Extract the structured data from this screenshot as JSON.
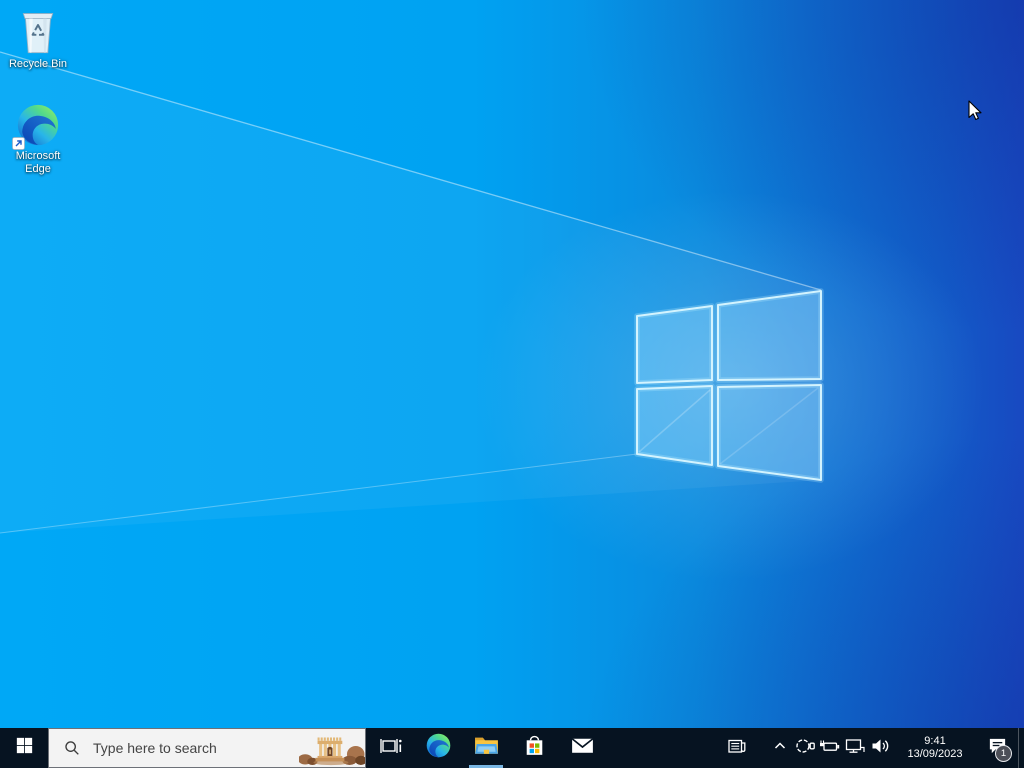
{
  "os": {
    "shell": "Windows 10 desktop",
    "accent_colors": {
      "wallpaper_left": "#00a8f6",
      "wallpaper_right": "#1849c1",
      "taskbar_background": "#061321",
      "running_indicator": "#79b6e3"
    }
  },
  "desktop_icons": [
    {
      "id": "recycle-bin",
      "label": "Recycle Bin",
      "icon": "recycle-bin-icon"
    },
    {
      "id": "microsoft-edge",
      "label_line1": "Microsoft",
      "label_line2": "Edge",
      "icon": "edge-icon"
    }
  ],
  "taskbar": {
    "start": {
      "icon": "windows-logo-icon"
    },
    "search": {
      "placeholder": "Type here to search",
      "icon": "search-icon",
      "highlight_icon": "temple-ruins-illustration"
    },
    "buttons": [
      {
        "id": "task-view",
        "icon": "task-view-icon",
        "running": false
      },
      {
        "id": "edge",
        "icon": "edge-icon",
        "running": false
      },
      {
        "id": "file-explorer",
        "icon": "file-explorer-icon",
        "running": true
      },
      {
        "id": "microsoft-store",
        "icon": "store-icon",
        "running": false
      },
      {
        "id": "mail",
        "icon": "mail-icon",
        "running": false
      }
    ],
    "tray": {
      "icons": [
        "news-icon",
        "hidden-icons-chevron",
        "meet-now-icon",
        "power-icon",
        "network-icon",
        "volume-icon"
      ],
      "time": "9:41",
      "date": "13/09/2023",
      "notification_badge": "1"
    }
  }
}
